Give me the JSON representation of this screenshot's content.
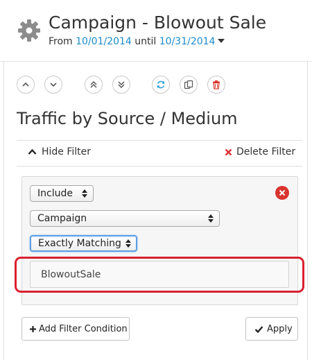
{
  "header": {
    "title": "Campaign - Blowout Sale",
    "from_label": "From",
    "start_date": "10/01/2014",
    "until_label": "until",
    "end_date": "10/31/2014"
  },
  "toolbar": {
    "icons": [
      "chevron-up-icon",
      "chevron-down-icon",
      "double-chevron-up-icon",
      "double-chevron-down-icon",
      "refresh-icon",
      "copy-icon",
      "trash-icon"
    ]
  },
  "report": {
    "title": "Traffic by Source / Medium"
  },
  "filter": {
    "hide_label": "Hide Filter",
    "delete_label": "Delete Filter",
    "include_value": "Include",
    "dimension_value": "Campaign",
    "match_value": "Exactly Matching",
    "text_value": "BlowoutSale",
    "add_condition_label": "Add Filter Condition",
    "apply_label": "Apply"
  },
  "colors": {
    "link": "#1a8cc9",
    "delete": "#d9332f",
    "highlight": "#d9202e",
    "focus": "#5b9fe3"
  }
}
